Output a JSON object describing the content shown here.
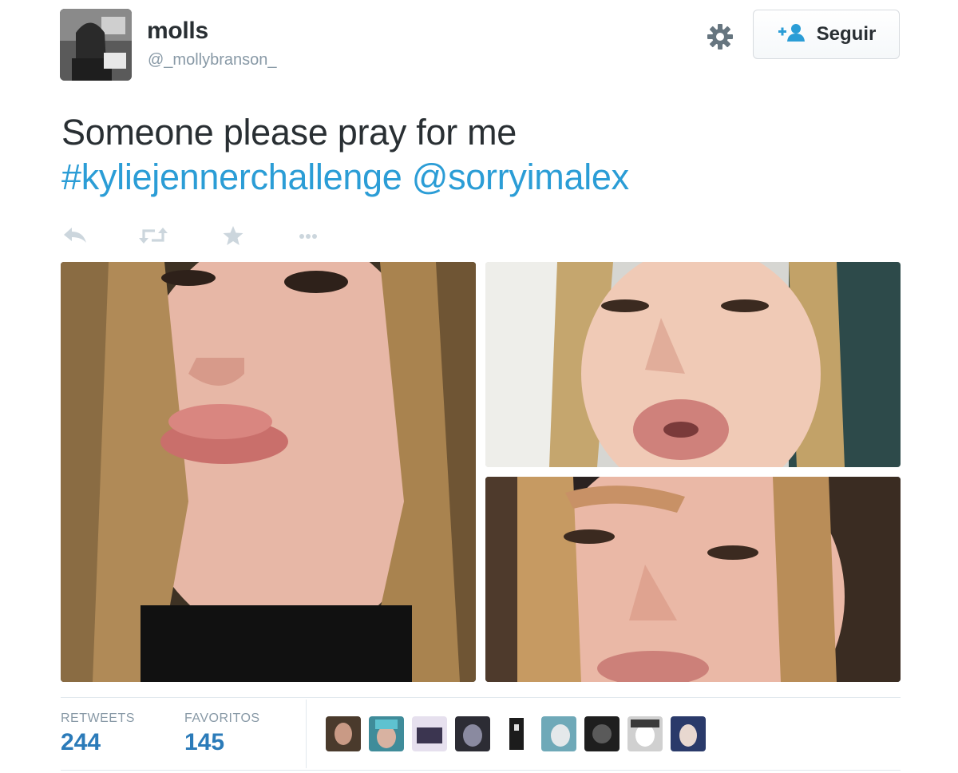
{
  "tweet": {
    "author": {
      "name": "molls",
      "handle": "@_mollybranson_"
    },
    "follow_label": "Seguir",
    "text_line1": "Someone please pray for me",
    "hashtag": "#kyliejennerchallenge",
    "mention": "@sorryimalex",
    "actions": [
      "reply-icon",
      "retweet-icon",
      "favorite-icon",
      "more-icon"
    ],
    "stats": {
      "retweets_label": "RETWEETS",
      "retweets_value": "244",
      "favorites_label": "FAVORITOS",
      "favorites_value": "145"
    },
    "favorited_by_count_shown": 9
  },
  "colors": {
    "link": "#2b9dd6",
    "stat_value": "#2b7bb9",
    "muted": "#8899a6",
    "text": "#292f33",
    "follow_icon": "#2b9dd6"
  }
}
